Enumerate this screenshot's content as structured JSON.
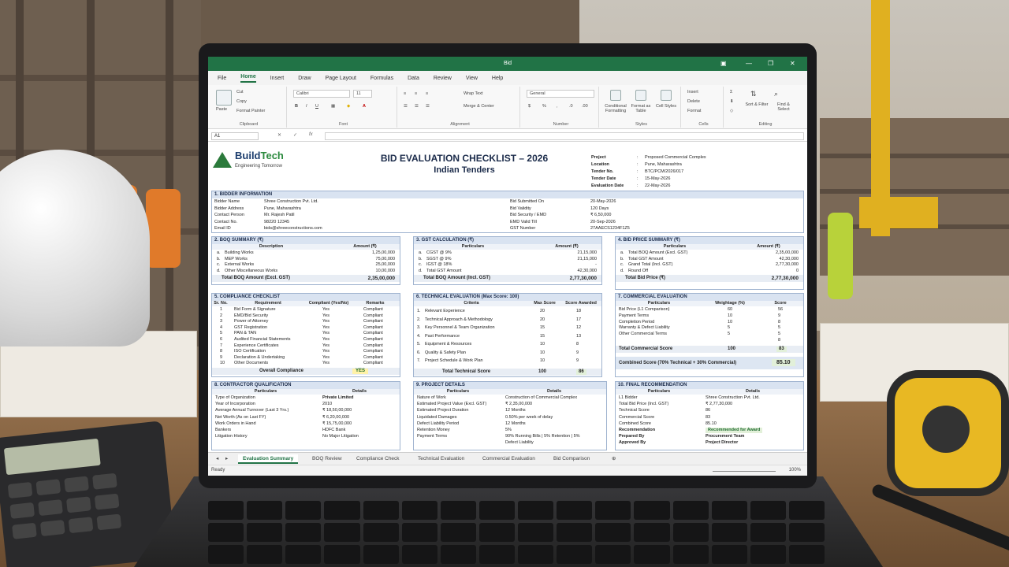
{
  "window": {
    "title": "Bid"
  },
  "menu": [
    "File",
    "Home",
    "Insert",
    "Draw",
    "Page Layout",
    "Formulas",
    "Data",
    "Review",
    "View",
    "Help"
  ],
  "ribbon": {
    "clipboard": {
      "paste": "Paste",
      "cut": "Cut",
      "copy": "Copy",
      "format_painter": "Format Painter",
      "label": "Clipboard"
    },
    "font": {
      "name": "Calibri",
      "size": "11",
      "label": "Font"
    },
    "alignment": {
      "wrap": "Wrap Text",
      "merge": "Merge & Center",
      "label": "Alignment"
    },
    "number": {
      "format": "General",
      "label": "Number"
    },
    "styles": {
      "cond": "Conditional Formatting",
      "fmt_table": "Format as Table",
      "cell_styles": "Cell Styles",
      "label": "Styles"
    },
    "cells": {
      "insert": "Insert",
      "delete": "Delete",
      "format": "Format",
      "label": "Cells"
    },
    "editing": {
      "sort": "Sort & Filter",
      "find": "Find & Select",
      "label": "Editing"
    }
  },
  "formula_bar": {
    "cell": "A1",
    "fx": "fx",
    "content": ""
  },
  "header": {
    "brand_a": "Build",
    "brand_b": "Tech",
    "tagline": "Engineering Tomorrow",
    "title": "BID EVALUATION CHECKLIST – 2026",
    "subtitle": "Indian Tenders",
    "project": [
      [
        "Project",
        "Proposed Commercial Complex"
      ],
      [
        "Location",
        "Pune, Maharashtra"
      ],
      [
        "Tender No.",
        "BTC/PCM/2026/017"
      ],
      [
        "Tender Date",
        "15-May-2026"
      ],
      [
        "Evaluation Date",
        "22-May-2026"
      ]
    ]
  },
  "bidder": {
    "title": "1. BIDDER INFORMATION",
    "left": [
      [
        "Bidder Name",
        "Shree Construction Pvt. Ltd."
      ],
      [
        "Bidder Address",
        "Pune, Maharashtra"
      ],
      [
        "Contact Person",
        "Mr. Rajesh Patil"
      ],
      [
        "Contact No.",
        "98220 12345"
      ],
      [
        "Email ID",
        "bids@shreeconstructions.com"
      ]
    ],
    "right": [
      [
        "Bid Submitted On",
        "20-May-2026"
      ],
      [
        "Bid Validity",
        "120 Days"
      ],
      [
        "Bid Security / EMD",
        "₹ 6,50,000"
      ],
      [
        "EMD Valid Till",
        "20-Sep-2026"
      ],
      [
        "GST Number",
        "27AAECS1234F1Z5"
      ]
    ]
  },
  "boq": {
    "title": "2. BOQ SUMMARY (₹)",
    "h1": "Description",
    "h2": "Amount (₹)",
    "rows": [
      [
        "a.",
        "Building Works",
        "1,25,00,000"
      ],
      [
        "b.",
        "MEP Works",
        "75,00,000"
      ],
      [
        "c.",
        "External Works",
        "25,00,000"
      ],
      [
        "d.",
        "Other Miscellaneous Works",
        "10,00,000"
      ]
    ],
    "total_label": "Total BOQ Amount (Excl. GST)",
    "total": "2,35,00,000"
  },
  "gst": {
    "title": "3. GST CALCULATION (₹)",
    "h1": "Particulars",
    "h2": "Amount (₹)",
    "rows": [
      [
        "a.",
        "CGST @ 9%",
        "21,15,000"
      ],
      [
        "b.",
        "SGST @ 9%",
        "21,15,000"
      ],
      [
        "c.",
        "IGST @ 18%",
        "-"
      ],
      [
        "d.",
        "Total GST Amount",
        "42,30,000"
      ]
    ],
    "total_label": "Total BOQ Amount (Incl. GST)",
    "total": "2,77,30,000"
  },
  "price": {
    "title": "4. BID PRICE SUMMARY (₹)",
    "h1": "Particulars",
    "h2": "Amount (₹)",
    "rows": [
      [
        "a.",
        "Total BOQ Amount (Excl. GST)",
        "2,35,00,000"
      ],
      [
        "b.",
        "Total GST Amount",
        "42,30,000"
      ],
      [
        "c.",
        "Grand Total (Incl. GST)",
        "2,77,30,000"
      ],
      [
        "d.",
        "Round Off",
        "0"
      ]
    ],
    "total_label": "Total Bid Price (₹)",
    "total": "2,77,30,000"
  },
  "compliance": {
    "title": "5. COMPLIANCE CHECKLIST",
    "h": [
      "Sr. No.",
      "Requirement",
      "Compliant (Yes/No)",
      "Remarks"
    ],
    "rows": [
      [
        "1",
        "Bid Form & Signature",
        "Yes",
        "Compliant"
      ],
      [
        "2",
        "EMD/Bid Security",
        "Yes",
        "Compliant"
      ],
      [
        "3",
        "Power of Attorney",
        "Yes",
        "Compliant"
      ],
      [
        "4",
        "GST Registration",
        "Yes",
        "Compliant"
      ],
      [
        "5",
        "PAN & TAN",
        "Yes",
        "Compliant"
      ],
      [
        "6",
        "Audited Financial Statements",
        "Yes",
        "Compliant"
      ],
      [
        "7",
        "Experience Certificates",
        "Yes",
        "Compliant"
      ],
      [
        "8",
        "ISO Certification",
        "Yes",
        "Compliant"
      ],
      [
        "9",
        "Declaration & Undertaking",
        "Yes",
        "Compliant"
      ],
      [
        "10",
        "Other Documents",
        "Yes",
        "Compliant"
      ]
    ],
    "total_label": "Overall Compliance",
    "total": "YES"
  },
  "technical": {
    "title": "6. TECHNICAL EVALUATION (Max Score: 100)",
    "h": [
      "Criteria",
      "Max Score",
      "Score Awarded"
    ],
    "rows": [
      [
        "1.",
        "Relevant Experience",
        "20",
        "18"
      ],
      [
        "2.",
        "Technical Approach & Methodology",
        "20",
        "17"
      ],
      [
        "3.",
        "Key Personnel & Team Organization",
        "15",
        "12"
      ],
      [
        "4.",
        "Past Performance",
        "15",
        "13"
      ],
      [
        "5.",
        "Equipment & Resources",
        "10",
        "8"
      ],
      [
        "6.",
        "Quality & Safety Plan",
        "10",
        "9"
      ],
      [
        "7.",
        "Project Schedule & Work Plan",
        "10",
        "9"
      ]
    ],
    "total_label": "Total Technical Score",
    "total_max": "100",
    "total": "86"
  },
  "commercial": {
    "title": "7. COMMERCIAL EVALUATION",
    "h": [
      "Particulars",
      "Weightage (%)",
      "Score"
    ],
    "rows": [
      [
        "Bid Price (L1 Comparison)",
        "60",
        "56"
      ],
      [
        "Payment Terms",
        "10",
        "9"
      ],
      [
        "Completion Period",
        "10",
        "8"
      ],
      [
        "Warranty & Defect Liability",
        "5",
        "5"
      ],
      [
        "Other Commercial Terms",
        "5",
        "5"
      ],
      [
        "",
        "",
        "8"
      ]
    ],
    "total_label": "Total Commercial Score",
    "total_max": "100",
    "total": "83",
    "combined_label": "Combined Score (70% Technical + 30% Commercial)",
    "combined": "85.10"
  },
  "contractor": {
    "title": "8. CONTRACTOR QUALIFICATION",
    "h": [
      "Particulars",
      "Details"
    ],
    "rows": [
      [
        "Type of Organization",
        "Private Limited"
      ],
      [
        "Year of Incorporation",
        "2010"
      ],
      [
        "Average Annual Turnover (Last 3 Yrs.)",
        "₹ 18,50,00,000"
      ],
      [
        "Net Worth (As on Last FY)",
        "₹ 6,20,00,000"
      ],
      [
        "Work Orders in Hand",
        "₹ 15,75,00,000"
      ],
      [
        "Bankers",
        "HDFC Bank"
      ],
      [
        "Litigation History",
        "No Major Litigation"
      ]
    ]
  },
  "project_details": {
    "title": "9. PROJECT DETAILS",
    "h": [
      "Particulars",
      "Details"
    ],
    "rows": [
      [
        "Nature of Work",
        "Construction of Commercial Complex"
      ],
      [
        "Estimated Project Value (Excl. GST)",
        "₹ 2,35,00,000"
      ],
      [
        "Estimated Project Duration",
        "12 Months"
      ],
      [
        "Liquidated Damages",
        "0.50% per week of delay"
      ],
      [
        "Defect Liability Period",
        "12 Months"
      ],
      [
        "Retention Money",
        "5%"
      ],
      [
        "Payment Terms",
        "90% Running Bills | 5% Retention | 5%"
      ],
      [
        "",
        "Defect Liability"
      ]
    ]
  },
  "recommendation": {
    "title": "10. FINAL RECOMMENDATION",
    "h": [
      "Particulars",
      "Details"
    ],
    "rows": [
      [
        "L1 Bidder",
        "Shree Construction Pvt. Ltd."
      ],
      [
        "Total Bid Price (Incl. GST)",
        "₹ 2,77,30,000"
      ],
      [
        "Technical Score",
        "86"
      ],
      [
        "Commercial Score",
        "83"
      ],
      [
        "Combined Score",
        "85.10"
      ],
      [
        "Recommendation",
        "Recommended for Award"
      ],
      [
        "Prepared By",
        "Procurement Team"
      ],
      [
        "Approved By",
        "Project Director"
      ]
    ]
  },
  "tabs": [
    "Evaluation Summary",
    "BOQ Review",
    "Compliance Check",
    "Technical Evaluation",
    "Commercial Evaluation",
    "Bid Comparison"
  ],
  "status": {
    "left": "Ready",
    "zoom": "100%"
  }
}
